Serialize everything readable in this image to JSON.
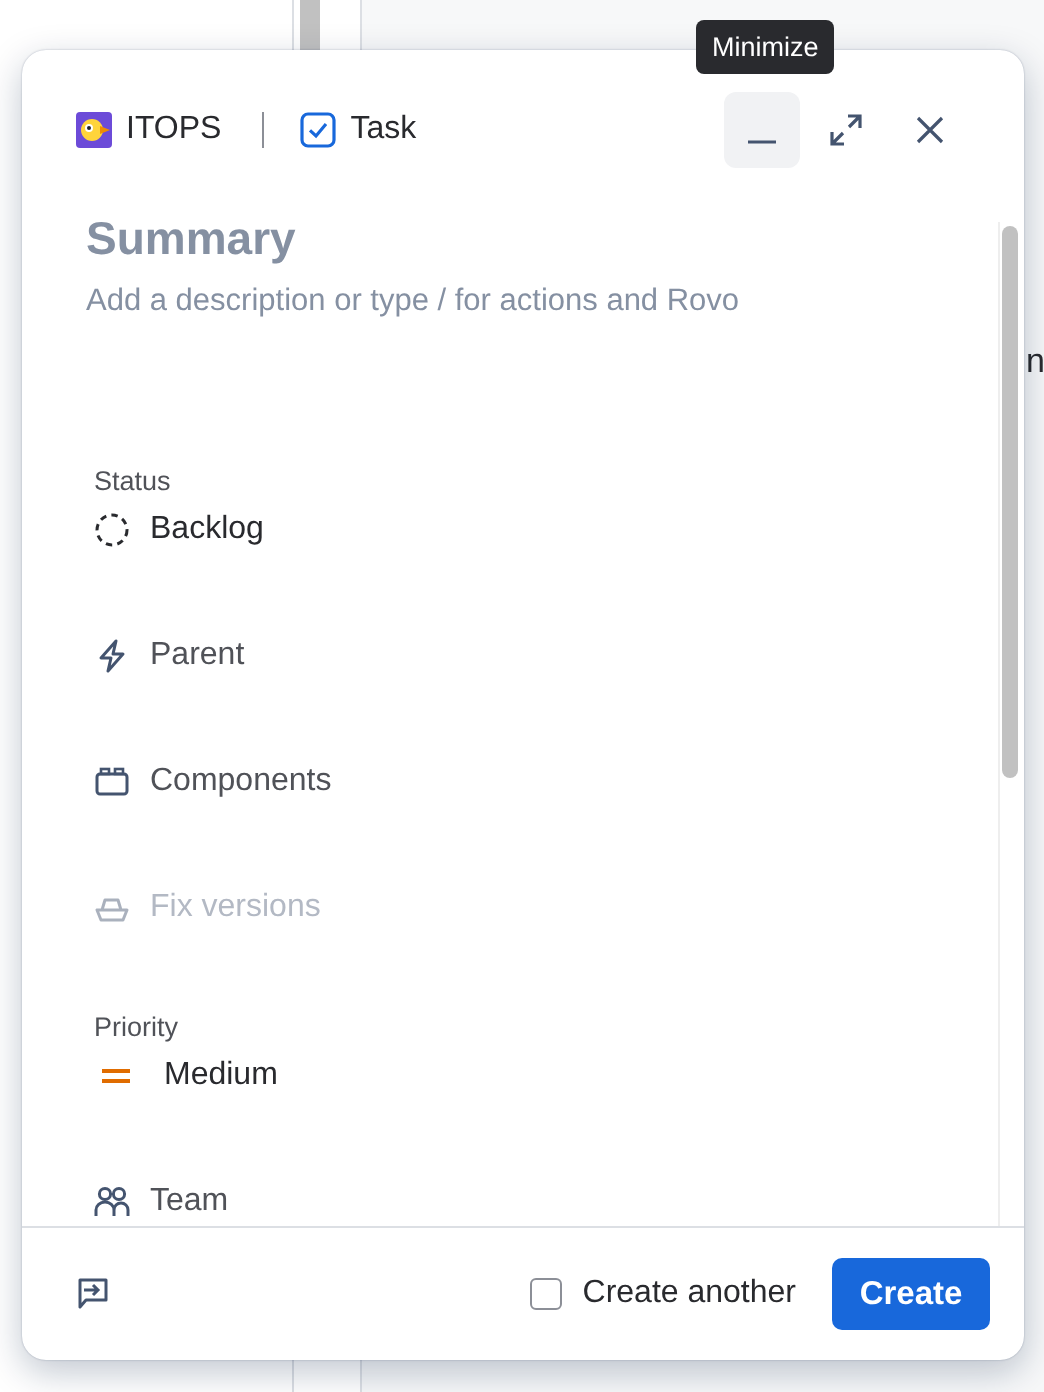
{
  "background": {
    "right_fragments": [
      "n"
    ]
  },
  "tooltip": "Minimize",
  "header": {
    "project": "ITOPS",
    "issue_type": "Task"
  },
  "summary": {
    "placeholder": "Summary"
  },
  "description": {
    "placeholder": "Add a description or type / for actions and Rovo"
  },
  "fields": [
    {
      "kind": "value",
      "label": "Status",
      "value": "Backlog",
      "disabled": false
    },
    {
      "kind": "empty",
      "label": "Parent",
      "disabled": false
    },
    {
      "kind": "empty",
      "label": "Components",
      "disabled": false
    },
    {
      "kind": "empty",
      "label": "Fix versions",
      "disabled": true
    },
    {
      "kind": "value",
      "label": "Priority",
      "value": "Medium",
      "disabled": false
    },
    {
      "kind": "empty",
      "label": "Team",
      "disabled": false
    }
  ],
  "footer": {
    "create_another": {
      "label": "Create another",
      "checked": false
    },
    "create_button": "Create"
  }
}
